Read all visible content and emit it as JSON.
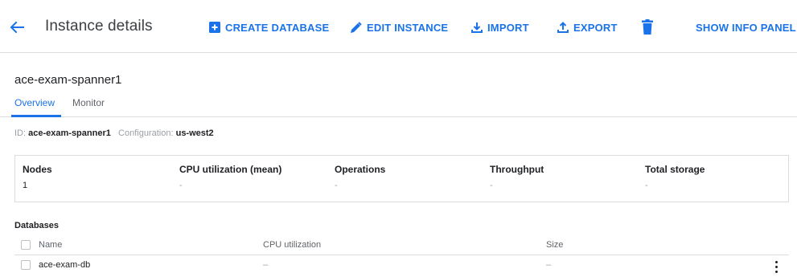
{
  "header": {
    "title": "Instance details",
    "actions": {
      "create_database": "CREATE DATABASE",
      "edit_instance": "EDIT INSTANCE",
      "import": "IMPORT",
      "export": "EXPORT",
      "show_info_panel": "SHOW INFO PANEL"
    },
    "icons": {
      "back": "arrow-back-icon",
      "create_database": "add-box-icon",
      "edit_instance": "pencil-icon",
      "import": "download-icon",
      "export": "upload-icon",
      "delete": "trash-icon"
    }
  },
  "instance": {
    "name": "ace-exam-spanner1",
    "id_label": "ID:",
    "id_value": "ace-exam-spanner1",
    "config_label": "Configuration:",
    "config_value": "us-west2"
  },
  "tabs": [
    {
      "label": "Overview",
      "active": true
    },
    {
      "label": "Monitor",
      "active": false
    }
  ],
  "stats": [
    {
      "label": "Nodes",
      "value": "1"
    },
    {
      "label": "CPU utilization (mean)",
      "value": "-"
    },
    {
      "label": "Operations",
      "value": "-"
    },
    {
      "label": "Throughput",
      "value": "-"
    },
    {
      "label": "Total storage",
      "value": "-"
    }
  ],
  "databases": {
    "title": "Databases",
    "columns": [
      "Name",
      "CPU utilization",
      "Size"
    ],
    "rows": [
      {
        "name": "ace-exam-db",
        "cpu": "–",
        "size": "–"
      }
    ]
  },
  "colors": {
    "accent": "#1a73e8",
    "text": "#202124",
    "muted": "#9aa0a6",
    "divider": "#dadce0"
  }
}
